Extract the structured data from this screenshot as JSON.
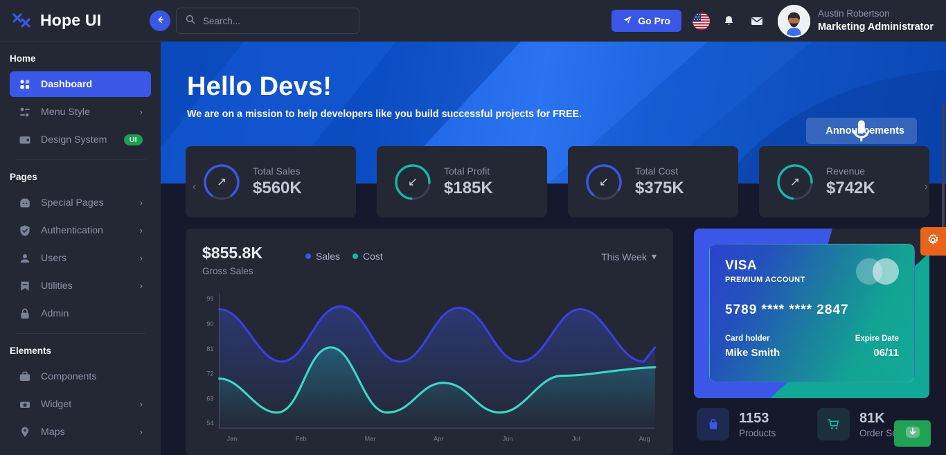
{
  "brand": {
    "name": "Hope UI",
    "logo_icon": "hope-ui-logo-icon"
  },
  "back_button": {
    "icon": "arrow-left-icon"
  },
  "sidebar": {
    "sections": [
      {
        "title": "Home",
        "items": [
          {
            "label": "Dashboard",
            "icon": "grid-icon",
            "active": true,
            "chevron": false,
            "badge": ""
          },
          {
            "label": "Menu Style",
            "icon": "sliders-icon",
            "active": false,
            "chevron": true,
            "badge": ""
          },
          {
            "label": "Design System",
            "icon": "wallet-icon",
            "active": false,
            "chevron": false,
            "badge": "UI"
          }
        ]
      },
      {
        "title": "Pages",
        "items": [
          {
            "label": "Special Pages",
            "icon": "gift-icon",
            "active": false,
            "chevron": true,
            "badge": ""
          },
          {
            "label": "Authentication",
            "icon": "shield-check-icon",
            "active": false,
            "chevron": true,
            "badge": ""
          },
          {
            "label": "Users",
            "icon": "users-icon",
            "active": false,
            "chevron": true,
            "badge": ""
          },
          {
            "label": "Utilities",
            "icon": "bookmark-icon",
            "active": false,
            "chevron": true,
            "badge": ""
          },
          {
            "label": "Admin",
            "icon": "lock-icon",
            "active": false,
            "chevron": false,
            "badge": ""
          }
        ]
      },
      {
        "title": "Elements",
        "items": [
          {
            "label": "Components",
            "icon": "briefcase-icon",
            "active": false,
            "chevron": false,
            "badge": ""
          },
          {
            "label": "Widget",
            "icon": "widget-icon",
            "active": false,
            "chevron": true,
            "badge": ""
          },
          {
            "label": "Maps",
            "icon": "map-pin-icon",
            "active": false,
            "chevron": true,
            "badge": ""
          }
        ]
      }
    ]
  },
  "topbar": {
    "search": {
      "placeholder": "Search...",
      "value": "",
      "icon": "search-icon"
    },
    "go_pro_label": "Go Pro",
    "go_pro_icon": "paper-plane-icon",
    "flag_icon": "usa-flag-icon",
    "bell_icon": "bell-icon",
    "mail_icon": "envelope-icon",
    "user": {
      "name": "Austin Robertson",
      "role": "Marketing Administrator",
      "avatar_icon": "user-avatar"
    }
  },
  "hero": {
    "title": "Hello Devs!",
    "subtitle": "We are on a mission to help developers like you build successful projects for FREE.",
    "announce_label": "Announcements",
    "announce_icon": "microphone-icon"
  },
  "stats": {
    "prev_icon": "chevron-left-icon",
    "next_icon": "chevron-right-icon",
    "cards": [
      {
        "label": "Total Sales",
        "value": "$560K",
        "arrow": "arrow-up-right-icon",
        "ring_color": "#3a57e8",
        "ring_pct": 80
      },
      {
        "label": "Total Profit",
        "value": "$185K",
        "arrow": "arrow-down-left-icon",
        "ring_color": "#14b8a6",
        "ring_pct": 72
      },
      {
        "label": "Total Cost",
        "value": "$375K",
        "arrow": "arrow-down-left-icon",
        "ring_color": "#3a57e8",
        "ring_pct": 68
      },
      {
        "label": "Revenue",
        "value": "$742K",
        "arrow": "arrow-up-right-icon",
        "ring_color": "#14b8a6",
        "ring_pct": 70
      }
    ]
  },
  "chart_panel": {
    "gross_value": "$855.8K",
    "gross_label": "Gross Sales",
    "range_label": "This Week",
    "range_icon": "chevron-down-icon"
  },
  "chart_data": {
    "type": "line",
    "title": "Gross Sales",
    "xlabel": "",
    "ylabel": "",
    "grid": false,
    "legend_position": "top-center",
    "x": [
      "Jan",
      "Feb",
      "Mar",
      "Apr",
      "Jun",
      "Jul",
      "Aug"
    ],
    "ylim": [
      54,
      99
    ],
    "yticks": [
      99,
      90,
      81,
      72,
      63,
      54
    ],
    "series": [
      {
        "name": "Sales",
        "color": "#3a40e8",
        "values": [
          93,
          85,
          95,
          84,
          95,
          84,
          94
        ]
      },
      {
        "name": "Cost",
        "color": "#3ed7c8",
        "values": [
          72,
          61,
          81,
          60,
          71,
          60,
          76
        ]
      }
    ]
  },
  "credit_card": {
    "brand": "VISA",
    "account_type": "PREMIUM ACCOUNT",
    "number": "5789  ****  ****  2847",
    "holder_label": "Card holder",
    "holder_name": "Mike Smith",
    "expire_label": "Expire Date",
    "expire_value": "06/11"
  },
  "mini_stats": [
    {
      "value": "1153",
      "label": "Products",
      "icon": "bag-icon",
      "icon_color": "#3a57e8",
      "bg": "#1e2a52"
    },
    {
      "value": "81K",
      "label": "Order Served",
      "icon": "cart-icon",
      "icon_color": "#14b8a6",
      "bg": "#1c2f3c"
    }
  ],
  "floating": {
    "settings_icon": "gear-icon",
    "settings_color": "#e8631b",
    "download_icon": "download-icon",
    "download_color": "#20a155"
  }
}
